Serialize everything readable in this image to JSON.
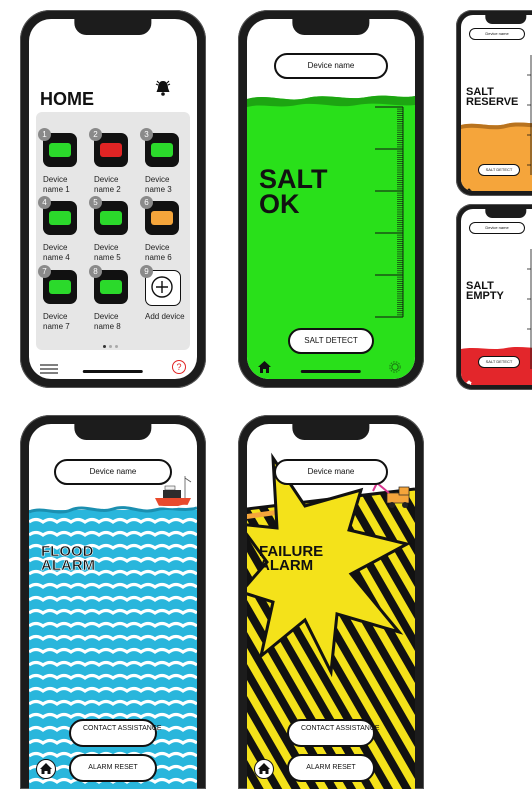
{
  "home": {
    "title": "HOME",
    "devices": [
      {
        "num": "1",
        "label": "Device name 1",
        "status": "#2bd92b"
      },
      {
        "num": "2",
        "label": "Device name 2",
        "status": "#e02424"
      },
      {
        "num": "3",
        "label": "Device name 3",
        "status": "#2bd92b"
      },
      {
        "num": "4",
        "label": "Device name 4",
        "status": "#2bd92b"
      },
      {
        "num": "5",
        "label": "Device name 5",
        "status": "#2bd92b"
      },
      {
        "num": "6",
        "label": "Device name 6",
        "status": "#f5a53b"
      },
      {
        "num": "7",
        "label": "Device name 7",
        "status": "#2bd92b"
      },
      {
        "num": "8",
        "label": "Device name 8",
        "status": "#2bd92b"
      }
    ],
    "add": {
      "num": "9",
      "label": "Add device"
    },
    "help_glyph": "?"
  },
  "salt_ok": {
    "device_name": "Device name",
    "status": "SALT OK",
    "button": "SALT DETECT",
    "bg": "#29e01a"
  },
  "salt_reserve": {
    "device_name": "Device name",
    "status": "SALT RESERVE",
    "button": "SALT DETECT",
    "fill": "#f5a53b"
  },
  "salt_empty": {
    "device_name": "Device name",
    "status": "SALT EMPTY",
    "button": "SALT DETECT",
    "fill": "#e3262b"
  },
  "flood": {
    "device_name": "Device name",
    "status": "FLOOD ALARM",
    "contact": "CONTACT ASSISTANCE",
    "reset": "ALARM RESET",
    "color": "#29b6dc"
  },
  "failure": {
    "device_name": "Device mane",
    "status": "FAILURE ALARM",
    "contact": "CONTACT ASSISTANCE",
    "reset": "ALARM RESET",
    "color": "#f4e21a"
  }
}
